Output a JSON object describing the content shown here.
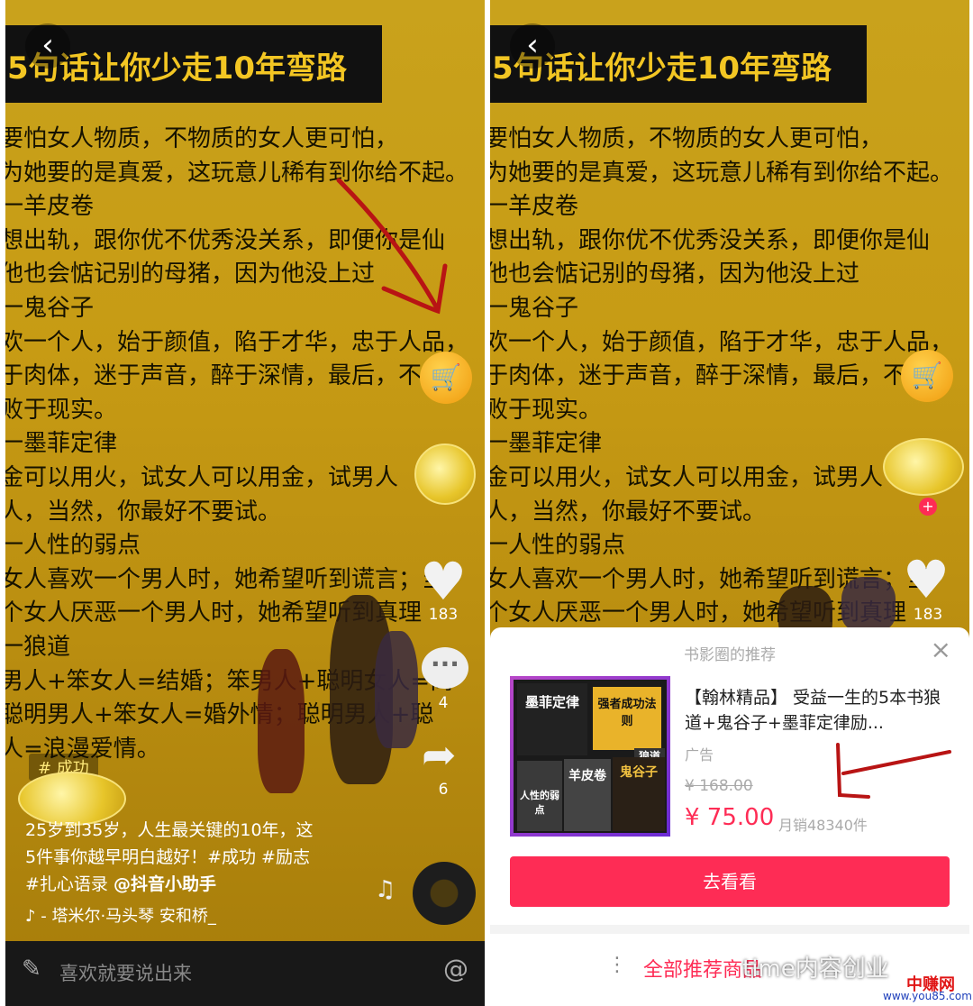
{
  "video": {
    "title": "5句话让你少走10年弯路",
    "lines": [
      "要怕女人物质，不物质的女人更可怕，",
      "为她要的是真爱，这玩意儿稀有到你给不起。",
      "一羊皮卷",
      "想出轨，跟你优不优秀没关系，即便你是仙",
      "  他也会惦记别的母猪，因为他没上过",
      "一鬼谷子",
      "欢一个人，始于颜值，陷于才华，忠于人品，",
      "于肉体，迷于声音，醉于深情，最后，不敌",
      "  败于现实。",
      "一墨菲定律",
      "金可以用火，试女人可以用金，试男人",
      "人，当然，你最好不要试。",
      "一人性的弱点",
      "女人喜欢一个男人时，她希望听到谎言；当",
      "个女人厌恶一个男人时，她希望听到真理",
      "一狼道",
      "男人+笨女人=结婚；笨男人+聪明女人=离",
      "  聪明男人+笨女人=婚外情；聪明男人+聪",
      "人=浪漫爱情。"
    ]
  },
  "actions": {
    "cart_icon": "shopping-cart-icon",
    "likes": "183",
    "comments": "4",
    "shares": "6",
    "follow_plus": "+"
  },
  "tag": "# 成功",
  "caption": {
    "line1": "25岁到35岁，人生最关键的10年，这",
    "line2": "5件事你越早明白越好！#成功 #励志",
    "line3_prefix": "#扎心语录 ",
    "mention": "@抖音小助手"
  },
  "music": {
    "glyph": "♪",
    "text": "- 塔米尔·马头琴    安和桥_"
  },
  "comment_bar": {
    "placeholder": "喜欢就要说出来",
    "at": "@"
  },
  "sheet": {
    "title": "书影圈的推荐",
    "close": "×",
    "product_name": "【翰林精品】 受益一生的5本书狼道+鬼谷子+墨菲定律励...",
    "ad_label": "广告",
    "original_price": "¥ 168.00",
    "price": "¥ 75.00",
    "sales": "月销48340件",
    "cta": "去看看",
    "all_recs": "全部推荐商品",
    "books": [
      "墨菲定律",
      "强者成功法则",
      "狼道",
      "羊皮卷",
      "鬼谷子",
      "人性的弱点"
    ]
  },
  "watermark": {
    "text": "time内容创业",
    "brand": "中赚网",
    "url": "www.you85.com"
  },
  "colors": {
    "accent": "#fe2c55",
    "title_text": "#f3c623",
    "annotation": "#b81414"
  }
}
